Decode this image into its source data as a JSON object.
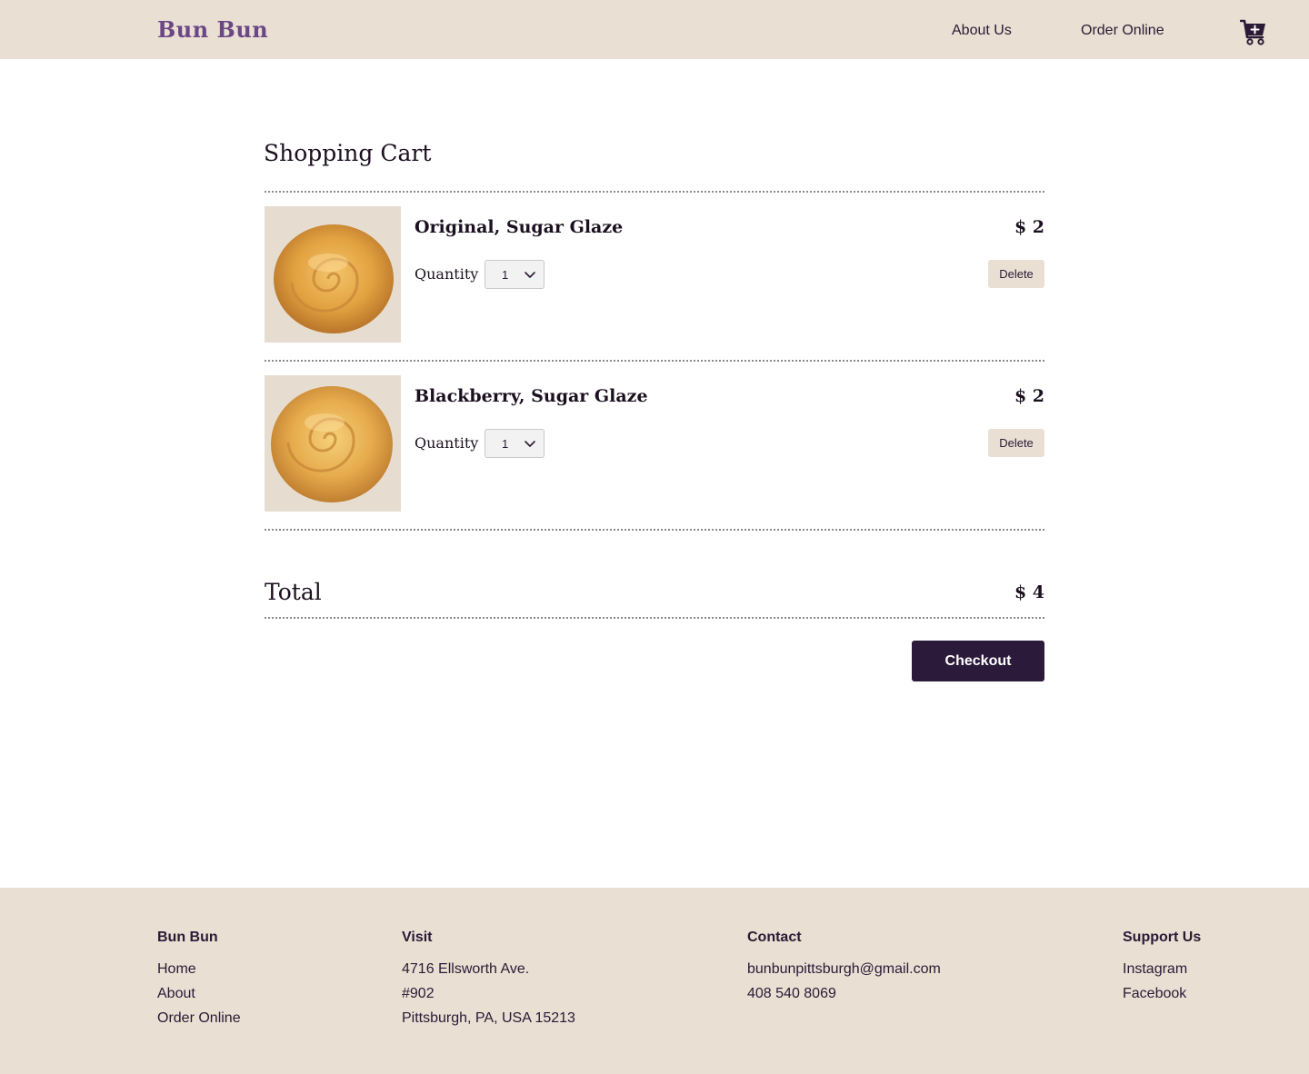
{
  "header": {
    "logo": "Bun Bun",
    "nav": {
      "about": "About Us",
      "order": "Order Online"
    }
  },
  "cart": {
    "title": "Shopping Cart",
    "quantity_label": "Quantity",
    "delete_label": "Delete",
    "items": [
      {
        "name": "Original, Sugar Glaze",
        "price": "$ 2",
        "quantity": "1"
      },
      {
        "name": "Blackberry, Sugar Glaze",
        "price": "$ 2",
        "quantity": "1"
      }
    ],
    "total_label": "Total",
    "total_value": "$ 4",
    "checkout_label": "Checkout"
  },
  "footer": {
    "brand": {
      "heading": "Bun Bun",
      "links": [
        "Home",
        "About",
        "Order Online"
      ]
    },
    "visit": {
      "heading": "Visit",
      "lines": [
        "4716 Ellsworth Ave.",
        "#902",
        "Pittsburgh, PA, USA 15213"
      ]
    },
    "contact": {
      "heading": "Contact",
      "lines": [
        "bunbunpittsburgh@gmail.com",
        "408 540 8069"
      ]
    },
    "support": {
      "heading": "Support Us",
      "links": [
        "Instagram",
        "Facebook"
      ]
    }
  },
  "colors": {
    "header_bg": "#eadfd3",
    "logo": "#6b4785",
    "checkout_bg": "#2b1a3a",
    "text": "#2a1a35"
  },
  "icons": {
    "cart": "cart-plus-icon",
    "select": "chevron-down-icon"
  }
}
